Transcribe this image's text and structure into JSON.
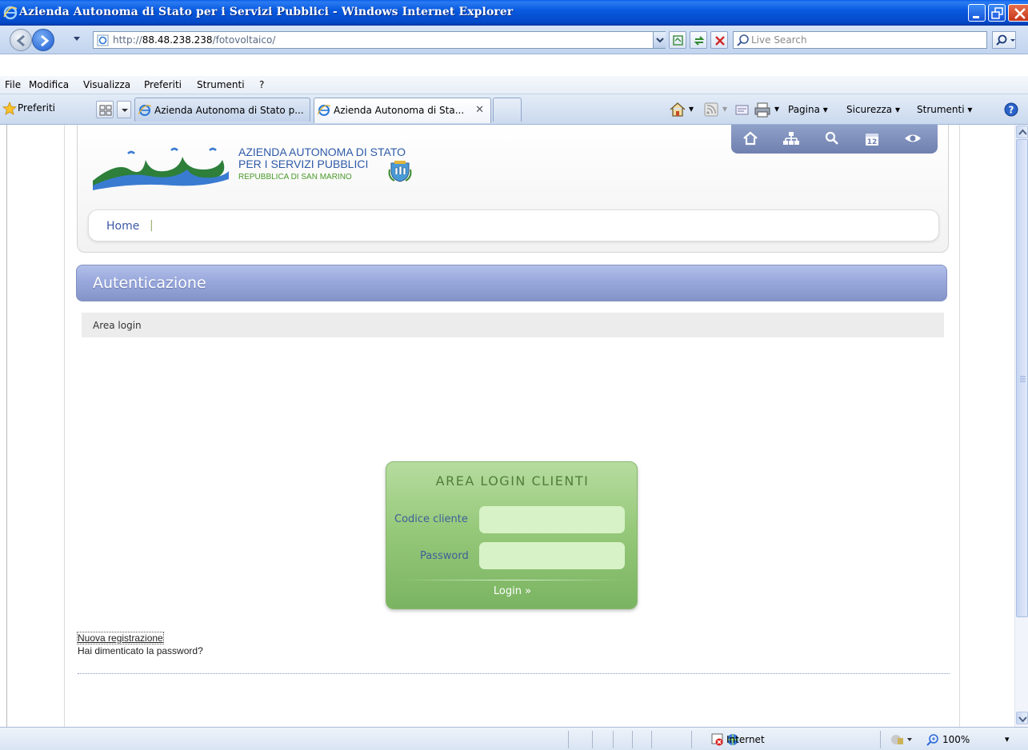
{
  "window": {
    "title": "Azienda Autonoma di Stato per i Servizi Pubblici - Windows Internet Explorer"
  },
  "address": {
    "url_prefix": "http://",
    "url_host": "88.48.238.238",
    "url_path": "/fotovoltaico/",
    "search_placeholder": "Live Search"
  },
  "menu": {
    "items": [
      "File",
      "Modifica",
      "Visualizza",
      "Preferiti",
      "Strumenti",
      "?"
    ]
  },
  "favorites": {
    "label": "Preferiti"
  },
  "tabs": [
    {
      "label": "Azienda Autonoma di Stato p...",
      "active": false
    },
    {
      "label": "Azienda Autonoma di Sta...",
      "active": true
    }
  ],
  "commandbar": {
    "page": "Pagina",
    "safety": "Sicurezza",
    "tools": "Strumenti"
  },
  "site": {
    "org_line1": "AZIENDA AUTONOMA DI STATO",
    "org_line2": "PER I SERVIZI PUBBLICI",
    "org_line3": "REPUBBLICA DI SAN MARINO",
    "nav_home": "Home",
    "nav_sep": "|",
    "calendar_day": "12"
  },
  "section": {
    "title": "Autenticazione",
    "breadcrumb": "Area login"
  },
  "login": {
    "title": "AREA LOGIN CLIENTI",
    "code_label": "Codice cliente",
    "password_label": "Password",
    "code_value": "",
    "password_value": "",
    "submit": "Login »"
  },
  "links": {
    "new_registration": "Nuova registrazione",
    "forgot_password": "Hai dimenticato la password?"
  },
  "status": {
    "zone": "Internet",
    "zoom": "100%"
  },
  "colors": {
    "titlebar": "#0449c8",
    "section": "#99a8dc",
    "login_green": "#97c97b",
    "field_green": "#d7f2c7"
  }
}
